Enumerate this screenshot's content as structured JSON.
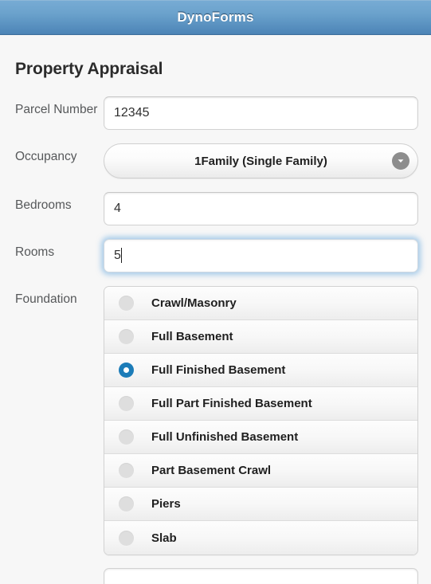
{
  "header": {
    "title": "DynoForms"
  },
  "page": {
    "title": "Property Appraisal"
  },
  "fields": {
    "parcel_number": {
      "label": "Parcel Number",
      "value": "12345",
      "placeholder": ""
    },
    "occupancy": {
      "label": "Occupancy",
      "selected": "1Family (Single Family)",
      "arrow_icon": "chevron-down-icon"
    },
    "bedrooms": {
      "label": "Bedrooms",
      "value": "4",
      "placeholder": ""
    },
    "rooms": {
      "label": "Rooms",
      "value": "5",
      "placeholder": "",
      "focused": true
    },
    "foundation": {
      "label": "Foundation",
      "selected": "Full Finished Basement",
      "options": [
        "Crawl/Masonry",
        "Full Basement",
        "Full Finished Basement",
        "Full Part Finished Basement",
        "Full Unfinished Basement",
        "Part Basement Crawl",
        "Piers",
        "Slab"
      ]
    }
  },
  "colors": {
    "header_top": "#77abd4",
    "header_bottom": "#4a80b2",
    "accent_selected": "#1c7cb8",
    "page_background": "#f7f7f7",
    "label_text": "#56585a",
    "focus_glow": "#64a8de"
  }
}
